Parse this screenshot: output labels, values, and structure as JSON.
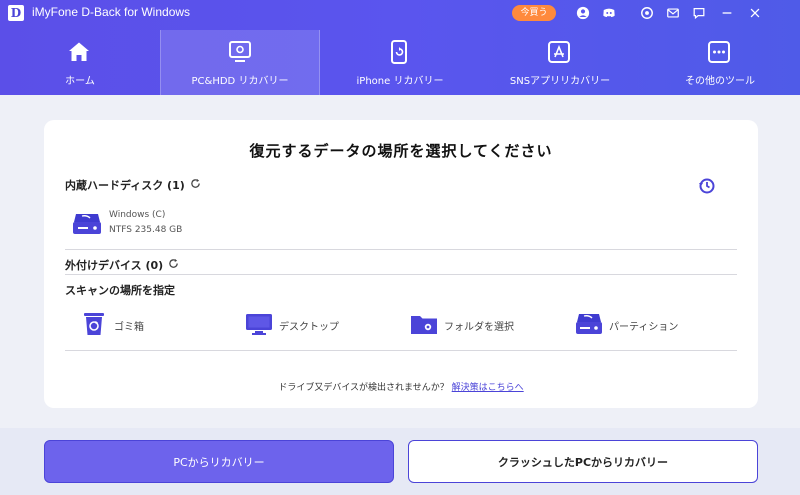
{
  "app": {
    "logo_letter": "D",
    "title": "iMyFone D-Back for Windows",
    "buy_label": "今買う",
    "accent_color": "#5a55ee",
    "titlebar_icons": [
      "user-icon",
      "discord-icon",
      "settings-icon",
      "mail-icon",
      "chat-icon",
      "minimize-icon",
      "close-icon"
    ]
  },
  "nav": {
    "tabs": [
      {
        "label": "ホーム",
        "icon": "home-icon",
        "active": false
      },
      {
        "label": "PC&HDD リカバリー",
        "icon": "pc-recovery-icon",
        "active": true
      },
      {
        "label": "iPhone リカバリー",
        "icon": "iphone-recovery-icon",
        "active": false
      },
      {
        "label": "SNSアプリリカバリー",
        "icon": "app-store-icon",
        "active": false
      },
      {
        "label": "その他のツール",
        "icon": "more-tools-icon",
        "active": false
      }
    ]
  },
  "main": {
    "title": "復元するデータの場所を選択してください",
    "internal_disk": {
      "label": "内蔵ハードディスク (1)",
      "drive": {
        "name": "Windows (C)",
        "info": "NTFS   235.48 GB"
      }
    },
    "external": {
      "label": "外付けデバイス (0)"
    },
    "scan": {
      "label": "スキャンの場所を指定",
      "items": [
        {
          "label": "ゴミ箱",
          "icon": "recycle-bin-icon"
        },
        {
          "label": "デスクトップ",
          "icon": "desktop-icon"
        },
        {
          "label": "フォルダを選択",
          "icon": "folder-icon"
        },
        {
          "label": "パーティション",
          "icon": "partition-icon"
        }
      ]
    },
    "footnote": {
      "text": "ドライブ又デバイスが検出されませんか？",
      "link": "解決策はこちらへ"
    }
  },
  "actions": {
    "primary": "PCからリカバリー",
    "secondary": "クラッシュしたPCからリカバリー"
  }
}
